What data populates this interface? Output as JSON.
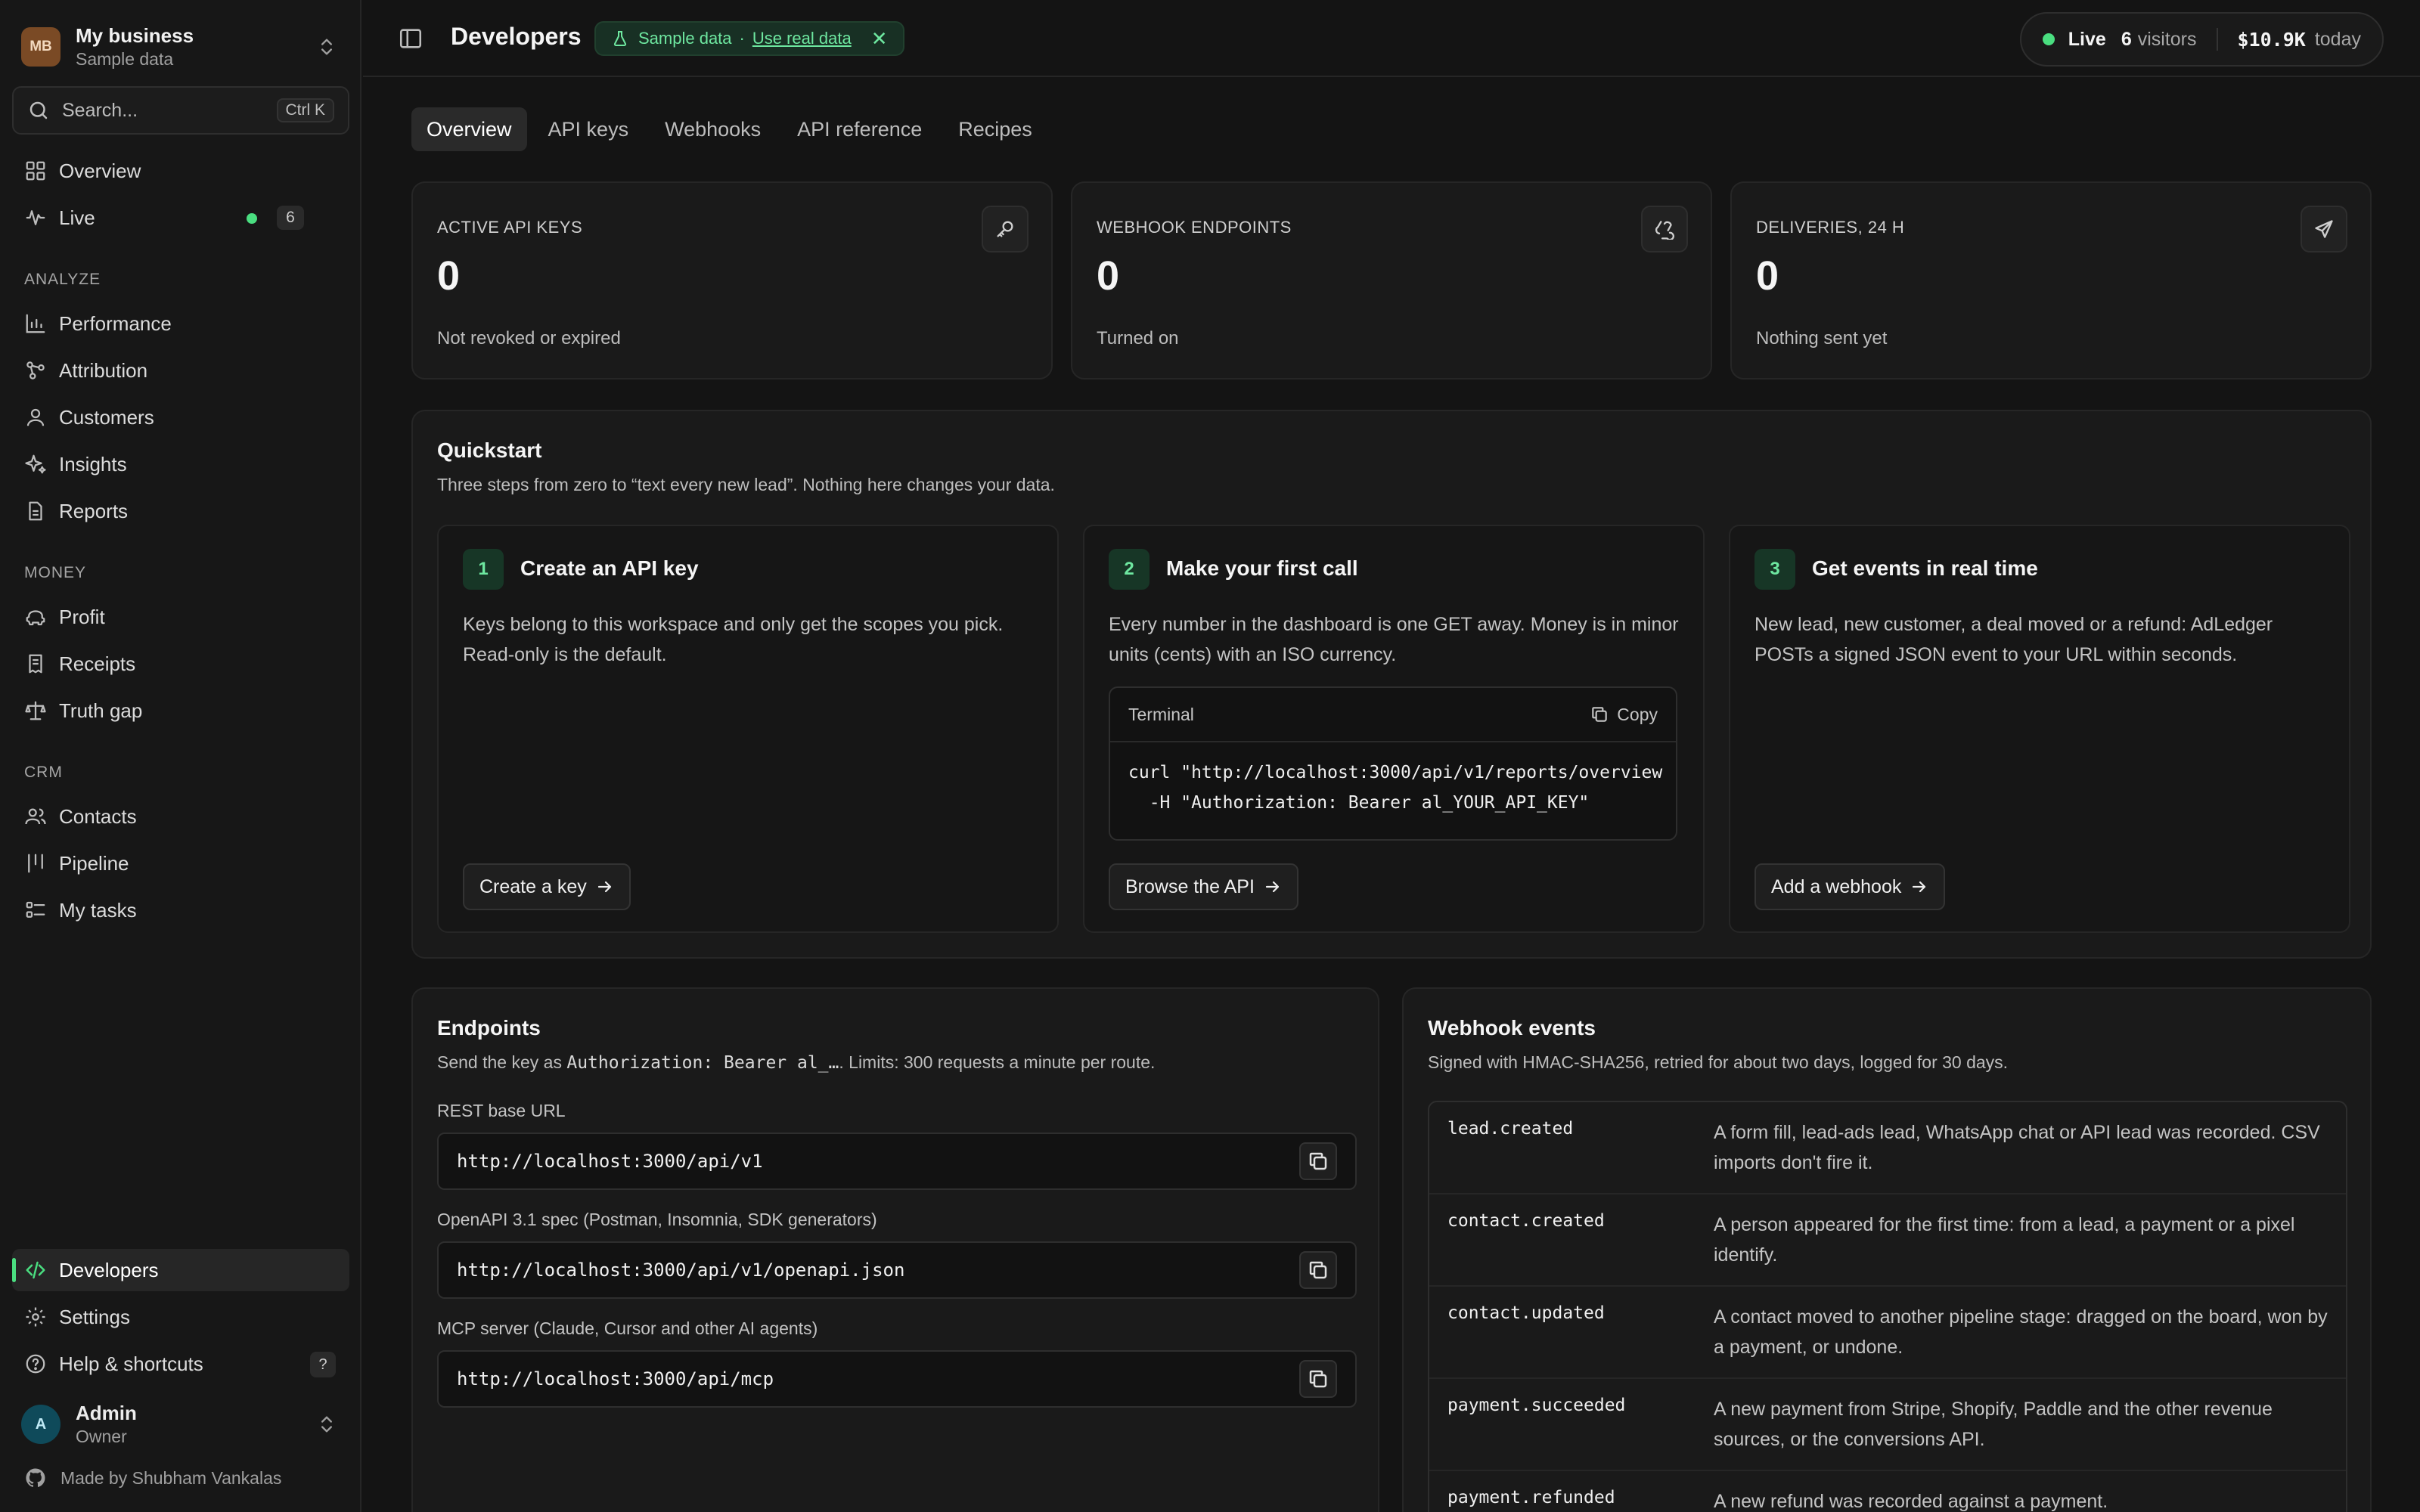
{
  "workspace": {
    "logo": "MB",
    "name": "My business",
    "subtitle": "Sample data"
  },
  "search": {
    "placeholder": "Search...",
    "shortcut": "Ctrl K"
  },
  "nav": {
    "overview": "Overview",
    "live": "Live",
    "live_count": "6",
    "section_analyze": "ANALYZE",
    "performance": "Performance",
    "attribution": "Attribution",
    "customers": "Customers",
    "insights": "Insights",
    "reports": "Reports",
    "section_money": "MONEY",
    "profit": "Profit",
    "receipts": "Receipts",
    "truth_gap": "Truth gap",
    "section_crm": "CRM",
    "contacts": "Contacts",
    "pipeline": "Pipeline",
    "my_tasks": "My tasks",
    "developers": "Developers",
    "settings": "Settings",
    "help": "Help & shortcuts",
    "help_key": "?"
  },
  "user": {
    "initial": "A",
    "name": "Admin",
    "role": "Owner"
  },
  "footer": {
    "made_by": "Made by Shubham Vankalas"
  },
  "header": {
    "title": "Developers",
    "sample_label": "Sample data",
    "separator": "·",
    "use_real": "Use real data",
    "close": "✕",
    "live_label": "Live",
    "visitors_count": "6",
    "visitors_label": "visitors",
    "revenue": "$10.9K",
    "revenue_period": "today"
  },
  "tabs": [
    "Overview",
    "API keys",
    "Webhooks",
    "API reference",
    "Recipes"
  ],
  "stats": [
    {
      "label": "ACTIVE API KEYS",
      "value": "0",
      "sub": "Not revoked or expired",
      "icon": "key-icon"
    },
    {
      "label": "WEBHOOK ENDPOINTS",
      "value": "0",
      "sub": "Turned on",
      "icon": "webhook-icon"
    },
    {
      "label": "DELIVERIES, 24 H",
      "value": "0",
      "sub": "Nothing sent yet",
      "icon": "send-icon"
    }
  ],
  "quickstart": {
    "title": "Quickstart",
    "subtitle": "Three steps from zero to “text every new lead”. Nothing here changes your data.",
    "steps": [
      {
        "num": "1",
        "title": "Create an API key",
        "desc": "Keys belong to this workspace and only get the scopes you pick. Read-only is the default.",
        "button": "Create a key"
      },
      {
        "num": "2",
        "title": "Make your first call",
        "desc": "Every number in the dashboard is one GET away. Money is in minor units (cents) with an ISO currency.",
        "button": "Browse the API"
      },
      {
        "num": "3",
        "title": "Get events in real time",
        "desc": "New lead, new customer, a deal moved or a refund: AdLedger POSTs a signed JSON event to your URL within seconds.",
        "button": "Add a webhook"
      }
    ],
    "terminal": {
      "label": "Terminal",
      "copy": "Copy",
      "line1": "curl \"http://localhost:3000/api/v1/reports/overview",
      "line2": "  -H \"Authorization: Bearer al_YOUR_API_KEY\""
    }
  },
  "endpoints": {
    "title": "Endpoints",
    "sub_prefix": "Send the key as",
    "sub_code": "Authorization: Bearer al_…",
    "sub_suffix": ". Limits: 300 requests a minute per route.",
    "fields": [
      {
        "label": "REST base URL",
        "url": "http://localhost:3000/api/v1"
      },
      {
        "label": "OpenAPI 3.1 spec (Postman, Insomnia, SDK generators)",
        "url": "http://localhost:3000/api/v1/openapi.json"
      },
      {
        "label": "MCP server (Claude, Cursor and other AI agents)",
        "url": "http://localhost:3000/api/mcp"
      }
    ]
  },
  "webhook_events": {
    "title": "Webhook events",
    "subtitle": "Signed with HMAC-SHA256, retried for about two days, logged for 30 days.",
    "events": [
      {
        "name": "lead.created",
        "desc": "A form fill, lead-ads lead, WhatsApp chat or API lead was recorded. CSV imports don't fire it."
      },
      {
        "name": "contact.created",
        "desc": "A person appeared for the first time: from a lead, a payment or a pixel identify."
      },
      {
        "name": "contact.updated",
        "desc": "A contact moved to another pipeline stage: dragged on the board, won by a payment, or undone."
      },
      {
        "name": "payment.succeeded",
        "desc": "A new payment from Stripe, Shopify, Paddle and the other revenue sources, or the conversions API."
      },
      {
        "name": "payment.refunded",
        "desc": "A new refund was recorded against a payment."
      }
    ]
  },
  "colors": {
    "accent": "#4ade80",
    "background": "#141414",
    "card": "#1a1a1a",
    "border": "#262626"
  }
}
